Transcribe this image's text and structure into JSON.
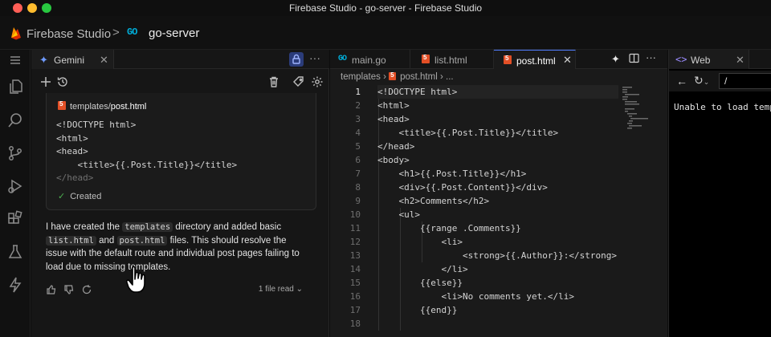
{
  "window": {
    "title": "Firebase Studio - go-server - Firebase Studio"
  },
  "header": {
    "brand": "Firebase Studio",
    "separator": ">",
    "project": "go-server"
  },
  "gemini": {
    "tab_label": "Gemini",
    "code_card": {
      "file_dir": "templates/",
      "file_name": "post.html",
      "lines": [
        "<!DOCTYPE html>",
        "<html>",
        "<head>",
        "    <title>{{.Post.Title}}</title>",
        "</head>"
      ],
      "status": "Created"
    },
    "message": {
      "p1": "I have created the",
      "chip1": "templates",
      "p2": "directory and added basic",
      "chip2": "list.html",
      "p3": "and",
      "chip3": "post.html",
      "p4": "files. This should resolve the issue with the default route and individual post pages failing to load due to missing templates."
    },
    "file_read": "1 file read"
  },
  "editor": {
    "tabs": [
      {
        "label": "main.go"
      },
      {
        "label": "list.html"
      },
      {
        "label": "post.html"
      }
    ],
    "breadcrumb": {
      "folder": "templates",
      "file": "post.html",
      "rest": "..."
    },
    "line_numbers": [
      "1",
      "2",
      "3",
      "4",
      "5",
      "6",
      "7",
      "8",
      "9",
      "10",
      "11",
      "12",
      "13",
      "14",
      "15",
      "16",
      "17",
      "18"
    ],
    "lines": [
      "<!DOCTYPE html>",
      "<html>",
      "<head>",
      "    <title>{{.Post.Title}}</title>",
      "</head>",
      "<body>",
      "    <h1>{{.Post.Title}}</h1>",
      "    <div>{{.Post.Content}}</div>",
      "",
      "    <h2>Comments</h2>",
      "    <ul>",
      "        {{range .Comments}}",
      "            <li>",
      "                <strong>{{.Author}}:</strong>",
      "            </li>",
      "        {{else}}",
      "            <li>No comments yet.</li>",
      "        {{end}}"
    ]
  },
  "web": {
    "tab_label": "Web",
    "url": "/",
    "body_text": "Unable to load templates"
  }
}
